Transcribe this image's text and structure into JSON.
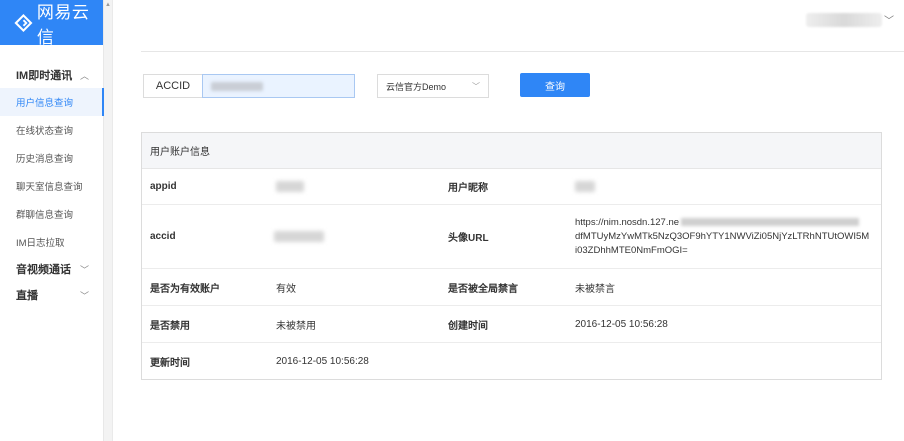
{
  "app": {
    "logo_text": "网易云信",
    "brand_color": "#2f86f6"
  },
  "sidebar": {
    "groups": [
      {
        "label": "IM即时通讯",
        "expanded": true,
        "items": [
          "用户信息查询",
          "在线状态查询",
          "历史消息查询",
          "聊天室信息查询",
          "群聊信息查询",
          "IM日志拉取"
        ]
      },
      {
        "label": "音视频通话",
        "expanded": false
      },
      {
        "label": "直播",
        "expanded": false
      }
    ],
    "active_item": "用户信息查询"
  },
  "search": {
    "accid_label": "ACCID",
    "app_select_value": "云信官方Demo",
    "query_button": "查询"
  },
  "panel": {
    "title": "用户账户信息",
    "rows": [
      {
        "label1": "appid",
        "value1": "",
        "label2": "用户昵称",
        "value2": ""
      },
      {
        "label1": "accid",
        "value1": "",
        "label2": "头像URL",
        "value2_prefix": "https://nim.nosdn.127.ne",
        "value2_rest": "dfMTUyMzYwMTk5NzQ3OF9hYTY1NWViZi05NjYzLTRhNTUtOWI5Mi03ZDhhMTE0NmFmOGI="
      },
      {
        "label1": "是否为有效账户",
        "value1": "有效",
        "label2": "是否被全局禁言",
        "value2": "未被禁言"
      },
      {
        "label1": "是否禁用",
        "value1": "未被禁用",
        "label2": "创建时间",
        "value2": "2016-12-05 10:56:28"
      },
      {
        "label1": "更新时间",
        "value1": "2016-12-05 10:56:28",
        "label2": "",
        "value2": ""
      }
    ]
  }
}
